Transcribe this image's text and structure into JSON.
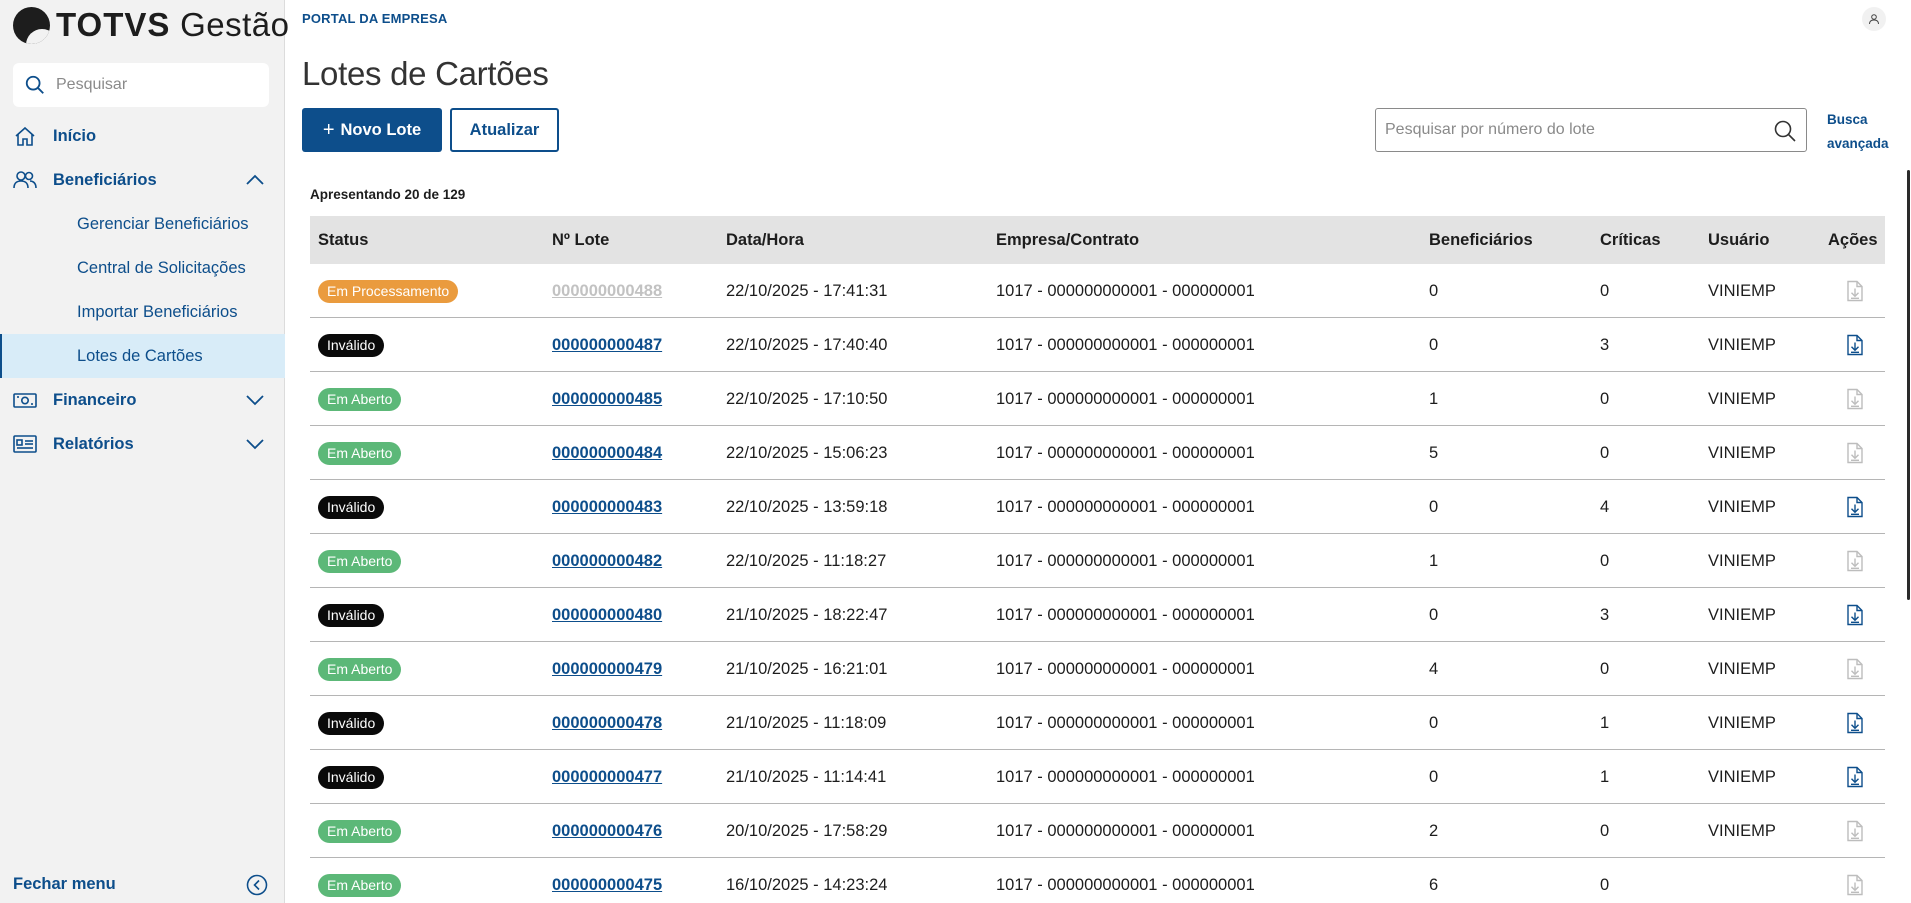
{
  "brand": {
    "name_bold": "TOTVS",
    "name_regular": "Gestão"
  },
  "sidebar": {
    "search_placeholder": "Pesquisar",
    "items": [
      {
        "label": "Início",
        "icon": "home-icon"
      },
      {
        "label": "Beneficiários",
        "icon": "users-icon",
        "expanded": true,
        "children": [
          {
            "label": "Gerenciar Beneficiários"
          },
          {
            "label": "Central de Solicitações"
          },
          {
            "label": "Importar Beneficiários"
          },
          {
            "label": "Lotes de Cartões",
            "active": true
          }
        ]
      },
      {
        "label": "Financeiro",
        "icon": "money-icon",
        "expanded": false
      },
      {
        "label": "Relatórios",
        "icon": "report-icon",
        "expanded": false
      }
    ],
    "close_label": "Fechar menu"
  },
  "header": {
    "portal_label": "PORTAL DA EMPRESA"
  },
  "page": {
    "title": "Lotes de Cartões",
    "new_button": "Novo Lote",
    "refresh_button": "Atualizar",
    "search_placeholder": "Pesquisar por número do lote",
    "advanced_search": "Busca avançada",
    "count_text": "Apresentando 20 de 129"
  },
  "table": {
    "columns": [
      "Status",
      "Nº Lote",
      "Data/Hora",
      "Empresa/Contrato",
      "Beneficiários",
      "Críticas",
      "Usuário",
      "Ações"
    ],
    "rows": [
      {
        "status": "Em Processamento",
        "status_color": "#ea9b3e",
        "lote": "000000000488",
        "lote_enabled": false,
        "datetime": "22/10/2025 - 17:41:31",
        "empresa": "1017 - 000000000001 - 000000001",
        "beneficiarios": "0",
        "criticas": "0",
        "usuario": "VINIEMP",
        "action_enabled": false
      },
      {
        "status": "Inválido",
        "status_color": "#0a0a0a",
        "lote": "000000000487",
        "lote_enabled": true,
        "datetime": "22/10/2025 - 17:40:40",
        "empresa": "1017 - 000000000001 - 000000001",
        "beneficiarios": "0",
        "criticas": "3",
        "usuario": "VINIEMP",
        "action_enabled": true
      },
      {
        "status": "Em Aberto",
        "status_color": "#5cb878",
        "lote": "000000000485",
        "lote_enabled": true,
        "datetime": "22/10/2025 - 17:10:50",
        "empresa": "1017 - 000000000001 - 000000001",
        "beneficiarios": "1",
        "criticas": "0",
        "usuario": "VINIEMP",
        "action_enabled": false
      },
      {
        "status": "Em Aberto",
        "status_color": "#5cb878",
        "lote": "000000000484",
        "lote_enabled": true,
        "datetime": "22/10/2025 - 15:06:23",
        "empresa": "1017 - 000000000001 - 000000001",
        "beneficiarios": "5",
        "criticas": "0",
        "usuario": "VINIEMP",
        "action_enabled": false
      },
      {
        "status": "Inválido",
        "status_color": "#0a0a0a",
        "lote": "000000000483",
        "lote_enabled": true,
        "datetime": "22/10/2025 - 13:59:18",
        "empresa": "1017 - 000000000001 - 000000001",
        "beneficiarios": "0",
        "criticas": "4",
        "usuario": "VINIEMP",
        "action_enabled": true
      },
      {
        "status": "Em Aberto",
        "status_color": "#5cb878",
        "lote": "000000000482",
        "lote_enabled": true,
        "datetime": "22/10/2025 - 11:18:27",
        "empresa": "1017 - 000000000001 - 000000001",
        "beneficiarios": "1",
        "criticas": "0",
        "usuario": "VINIEMP",
        "action_enabled": false
      },
      {
        "status": "Inválido",
        "status_color": "#0a0a0a",
        "lote": "000000000480",
        "lote_enabled": true,
        "datetime": "21/10/2025 - 18:22:47",
        "empresa": "1017 - 000000000001 - 000000001",
        "beneficiarios": "0",
        "criticas": "3",
        "usuario": "VINIEMP",
        "action_enabled": true
      },
      {
        "status": "Em Aberto",
        "status_color": "#5cb878",
        "lote": "000000000479",
        "lote_enabled": true,
        "datetime": "21/10/2025 - 16:21:01",
        "empresa": "1017 - 000000000001 - 000000001",
        "beneficiarios": "4",
        "criticas": "0",
        "usuario": "VINIEMP",
        "action_enabled": false
      },
      {
        "status": "Inválido",
        "status_color": "#0a0a0a",
        "lote": "000000000478",
        "lote_enabled": true,
        "datetime": "21/10/2025 - 11:18:09",
        "empresa": "1017 - 000000000001 - 000000001",
        "beneficiarios": "0",
        "criticas": "1",
        "usuario": "VINIEMP",
        "action_enabled": true
      },
      {
        "status": "Inválido",
        "status_color": "#0a0a0a",
        "lote": "000000000477",
        "lote_enabled": true,
        "datetime": "21/10/2025 - 11:14:41",
        "empresa": "1017 - 000000000001 - 000000001",
        "beneficiarios": "0",
        "criticas": "1",
        "usuario": "VINIEMP",
        "action_enabled": true
      },
      {
        "status": "Em Aberto",
        "status_color": "#5cb878",
        "lote": "000000000476",
        "lote_enabled": true,
        "datetime": "20/10/2025 - 17:58:29",
        "empresa": "1017 - 000000000001 - 000000001",
        "beneficiarios": "2",
        "criticas": "0",
        "usuario": "VINIEMP",
        "action_enabled": false
      },
      {
        "status": "Em Aberto",
        "status_color": "#5cb878",
        "lote": "000000000475",
        "lote_enabled": true,
        "datetime": "16/10/2025 - 14:23:24",
        "empresa": "1017 - 000000000001 - 000000001",
        "beneficiarios": "6",
        "criticas": "0",
        "usuario": "",
        "action_enabled": false
      }
    ]
  },
  "colors": {
    "primary": "#0d4e8b",
    "active_bg": "#d8ecf8",
    "header_bg": "#e3e3e3"
  }
}
